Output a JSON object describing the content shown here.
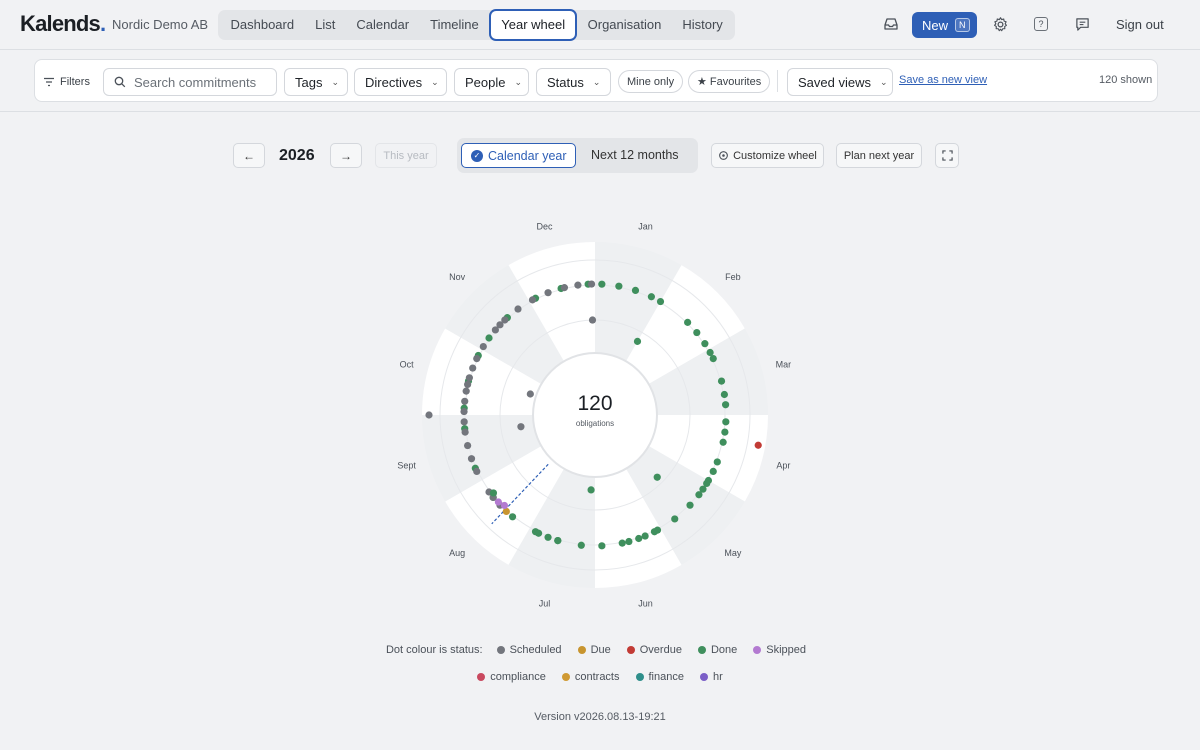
{
  "app": {
    "logo": "Kalends",
    "org": "Nordic Demo AB"
  },
  "nav": {
    "tabs": [
      "Dashboard",
      "List",
      "Calendar",
      "Timeline",
      "Year wheel",
      "Organisation",
      "History"
    ],
    "active": "Year wheel",
    "new_label": "New",
    "new_shortcut": "N",
    "signout": "Sign out"
  },
  "filters": {
    "label": "Filters",
    "search_placeholder": "Search commitments",
    "tags": "Tags",
    "directives": "Directives",
    "people": "People",
    "status": "Status",
    "mine_only": "Mine only",
    "favourites": "Favourites",
    "saved_views": "Saved views",
    "save_new": "Save as new view",
    "shown": "120 shown"
  },
  "year_controls": {
    "year": "2026",
    "this_year": "This year",
    "calendar_year": "Calendar year",
    "next_12": "Next 12 months",
    "customize": "Customize wheel",
    "plan_next": "Plan next year"
  },
  "wheel": {
    "total": "120",
    "total_label": "obligations",
    "months": [
      "Jan",
      "Feb",
      "Mar",
      "Apr",
      "May",
      "Jun",
      "Jul",
      "Aug",
      "Sept",
      "Oct",
      "Nov",
      "Dec"
    ]
  },
  "legend": {
    "intro": "Dot colour is status:",
    "statuses": [
      {
        "name": "Scheduled",
        "color": "#73767d"
      },
      {
        "name": "Due",
        "color": "#c8952f"
      },
      {
        "name": "Overdue",
        "color": "#c23b35"
      },
      {
        "name": "Done",
        "color": "#3f8f5d"
      },
      {
        "name": "Skipped",
        "color": "#b37ad1"
      }
    ],
    "tags": [
      {
        "name": "compliance",
        "color": "#c9495f"
      },
      {
        "name": "contracts",
        "color": "#d09a33"
      },
      {
        "name": "finance",
        "color": "#2f8f8b"
      },
      {
        "name": "hr",
        "color": "#7b5fc7"
      }
    ]
  },
  "version": "Version v2026.08.13-19:21"
}
